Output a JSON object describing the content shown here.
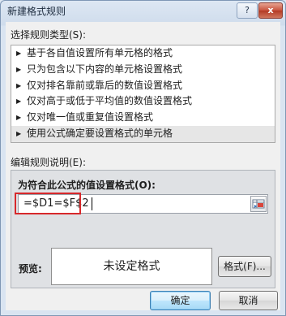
{
  "window": {
    "title": "新建格式规则",
    "help_label": "?",
    "close_label": "x"
  },
  "rule_type": {
    "label": "选择规则类型(S):",
    "items": [
      "基于各自值设置所有单元格的格式",
      "只为包含以下内容的单元格设置格式",
      "仅对排名靠前或靠后的数值设置格式",
      "仅对高于或低于平均值的数值设置格式",
      "仅对唯一值或重复值设置格式",
      "使用公式确定要设置格式的单元格"
    ],
    "selected_index": 5,
    "bullet": "▶"
  },
  "rule_description": {
    "label": "编辑规则说明(E):",
    "formula_label": "为符合此公式的值设置格式(O):",
    "formula_value": "=$D1=$F$2",
    "preview_label": "预览:",
    "preview_text": "未设定格式",
    "format_button": "格式(F)..."
  },
  "footer": {
    "ok_button": "确定",
    "cancel_button": "取消"
  },
  "colors": {
    "highlight_border": "#d7282b",
    "selected_item_bg": "#e6e6e6"
  }
}
